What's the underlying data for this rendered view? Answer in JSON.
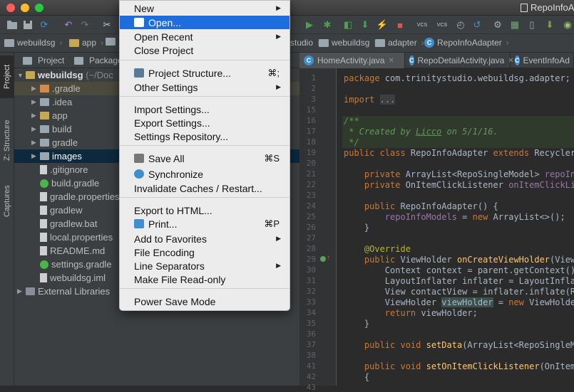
{
  "window": {
    "title": "RepoInfoAdapter"
  },
  "navbar": {
    "crumbs": [
      "webuildsg",
      "app",
      "webuildsg",
      "adapter",
      "RepoInfoAdapter"
    ],
    "partial": "studio"
  },
  "sidebar": {
    "tabs": [
      "Project",
      "Z: Structure",
      "Captures"
    ]
  },
  "panel": {
    "tabs": [
      "Project",
      "Packages"
    ]
  },
  "tree": {
    "root": "webuildsg",
    "root_path": "(~/Doc",
    "items": [
      {
        "label": ".gradle",
        "icon": "excl"
      },
      {
        "label": ".idea",
        "icon": "folder"
      },
      {
        "label": "app",
        "icon": "mod"
      },
      {
        "label": "build",
        "icon": "folder"
      },
      {
        "label": "gradle",
        "icon": "folder"
      },
      {
        "label": "images",
        "icon": "folder"
      },
      {
        "label": ".gitignore",
        "icon": "file"
      },
      {
        "label": "build.gradle",
        "icon": "gradle"
      },
      {
        "label": "gradle.properties",
        "icon": "file"
      },
      {
        "label": "gradlew",
        "icon": "file"
      },
      {
        "label": "gradlew.bat",
        "icon": "file"
      },
      {
        "label": "local.properties",
        "icon": "file"
      },
      {
        "label": "README.md",
        "icon": "file"
      },
      {
        "label": "settings.gradle",
        "icon": "gradle"
      },
      {
        "label": "webuildsg.iml",
        "icon": "file"
      }
    ],
    "external": "External Libraries"
  },
  "editor": {
    "tabs": [
      "HomeActivity.java",
      "RepoDetailActivity.java",
      "EventInfoAd"
    ],
    "line_numbers": [
      "1",
      "2",
      "3",
      "15",
      "16",
      "17",
      "18",
      "19",
      "20",
      "21",
      "22",
      "23",
      "24",
      "25",
      "26",
      "27",
      "28",
      "29",
      "30",
      "31",
      "32",
      "33",
      "34",
      "35",
      "36",
      "37",
      "38",
      "41",
      "42",
      "43"
    ]
  },
  "menu": {
    "items": [
      {
        "label": "New",
        "submenu": true
      },
      {
        "label": "Open...",
        "active": true,
        "icon": "folder"
      },
      {
        "label": "Open Recent",
        "submenu": true
      },
      {
        "label": "Close Project"
      },
      {
        "label": "Project Structure...",
        "shortcut": "⌘;",
        "icon": "structure"
      },
      {
        "label": "Other Settings",
        "submenu": true
      },
      {
        "label": "Import Settings..."
      },
      {
        "label": "Export Settings..."
      },
      {
        "label": "Settings Repository..."
      },
      {
        "label": "Save All",
        "shortcut": "⌘S",
        "icon": "save"
      },
      {
        "label": "Synchronize",
        "icon": "sync"
      },
      {
        "label": "Invalidate Caches / Restart..."
      },
      {
        "label": "Export to HTML..."
      },
      {
        "label": "Print...",
        "shortcut": "⌘P",
        "icon": "print"
      },
      {
        "label": "Add to Favorites",
        "submenu": true
      },
      {
        "label": "File Encoding"
      },
      {
        "label": "Line Separators",
        "submenu": true
      },
      {
        "label": "Make File Read-only"
      },
      {
        "label": "Power Save Mode"
      }
    ]
  }
}
